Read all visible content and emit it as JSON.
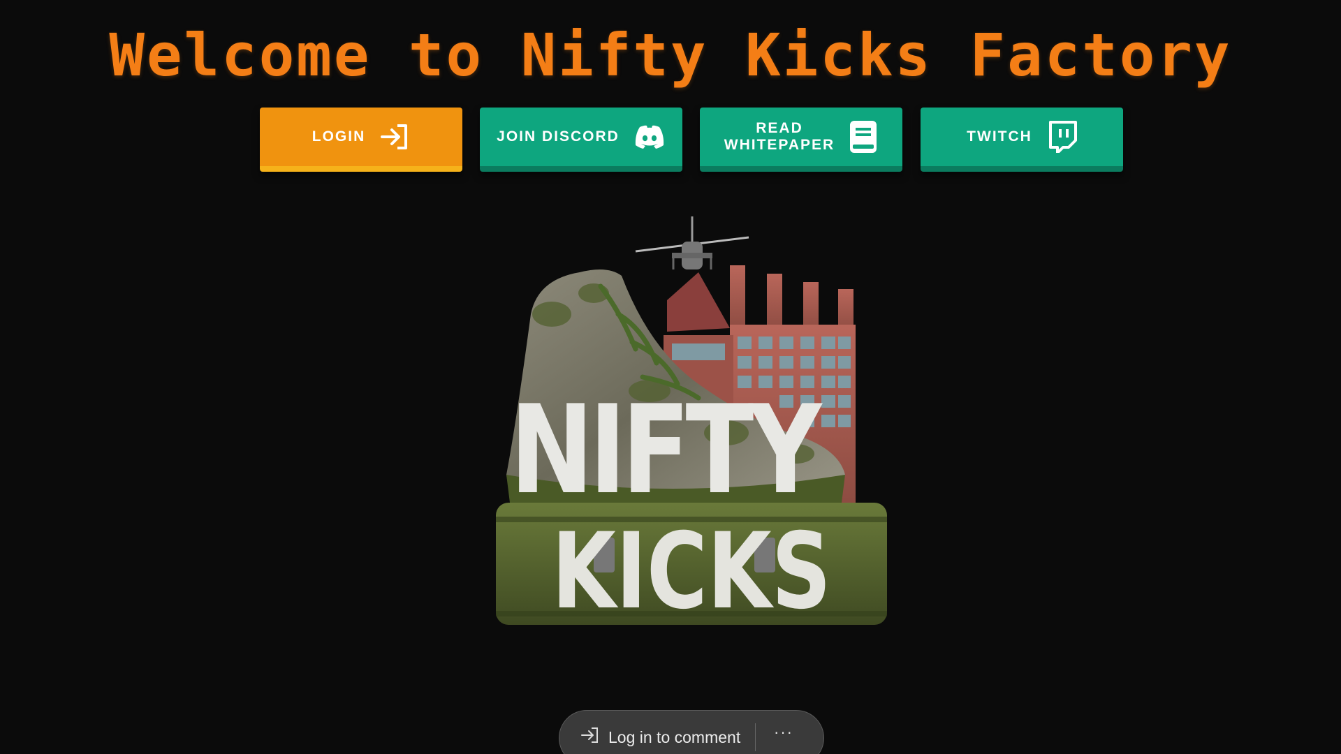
{
  "header": {
    "title": "Welcome to Nifty Kicks Factory"
  },
  "buttons": {
    "login": {
      "label": "LOGIN",
      "icon": "login-arrow-icon"
    },
    "discord": {
      "label": "JOIN DISCORD",
      "icon": "discord-icon"
    },
    "whitepaper": {
      "label_line1": "READ",
      "label_line2": "WHITEPAPER",
      "icon": "book-icon"
    },
    "twitch": {
      "label": "TWITCH",
      "icon": "twitch-icon"
    }
  },
  "logo": {
    "word1": "NIFTY",
    "word2": "KICKS"
  },
  "comment_bar": {
    "login_label": "Log in to comment",
    "more_label": "···"
  },
  "colors": {
    "title": "#f47e16",
    "login_button": "#f0930f",
    "social_buttons": "#0ea67f",
    "background": "#0b0b0b"
  }
}
